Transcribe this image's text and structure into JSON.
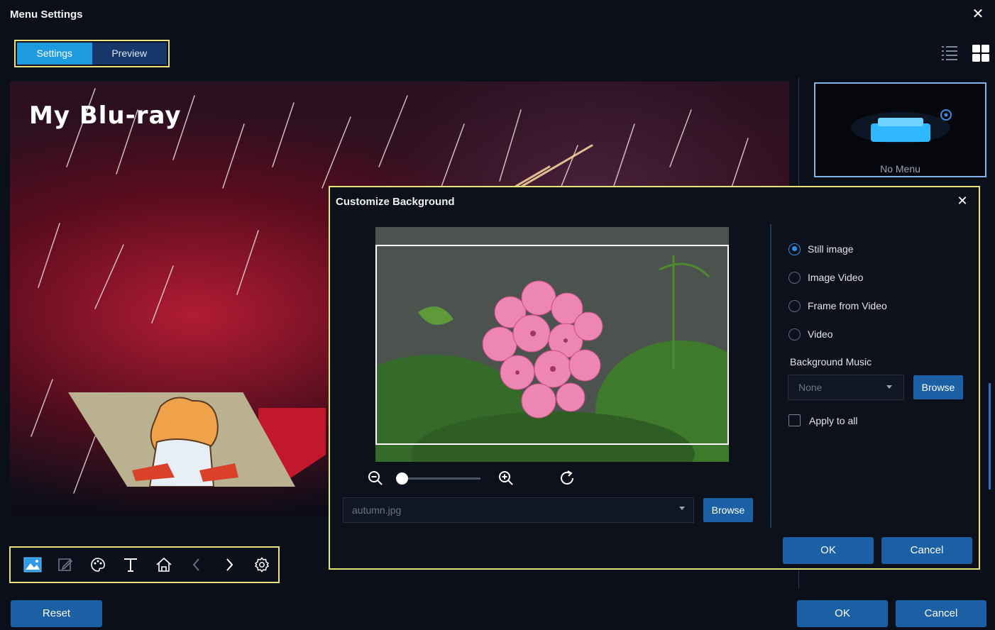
{
  "window": {
    "title": "Menu Settings",
    "close_glyph": "✕"
  },
  "tabs": [
    {
      "label": "Settings",
      "active": true
    },
    {
      "label": "Preview",
      "active": false
    }
  ],
  "view_icons": [
    "list-view-icon",
    "grid-view-icon"
  ],
  "preview": {
    "title": "My Blu-ray"
  },
  "toolbar_icons": [
    "image-icon",
    "edit-icon",
    "palette-icon",
    "text-icon",
    "home-icon",
    "chevron-left-icon",
    "chevron-right-icon",
    "settings-icon"
  ],
  "side_panel": {
    "menu_thumb_label": "No Menu"
  },
  "dialog": {
    "title": "Customize Background",
    "close_glyph": "✕",
    "file": {
      "value": "autumn.jpg"
    },
    "browse_label": "Browse",
    "options": [
      {
        "label": "Still image",
        "selected": true
      },
      {
        "label": "Image Video",
        "selected": false
      },
      {
        "label": "Frame from Video",
        "selected": false
      },
      {
        "label": "Video",
        "selected": false
      }
    ],
    "music": {
      "label": "Background Music",
      "value": "None",
      "browse_label": "Browse"
    },
    "apply_all": {
      "label": "Apply to all",
      "checked": false
    },
    "zoom": {
      "level": 0
    },
    "ok_label": "OK",
    "cancel_label": "Cancel"
  },
  "footer": {
    "reset_label": "Reset",
    "ok_label": "OK",
    "cancel_label": "Cancel"
  },
  "colors": {
    "accent": "#1d9be0",
    "button": "#1b5fa5",
    "highlight_border": "#e8e27a",
    "background": "#0b0f1a"
  }
}
